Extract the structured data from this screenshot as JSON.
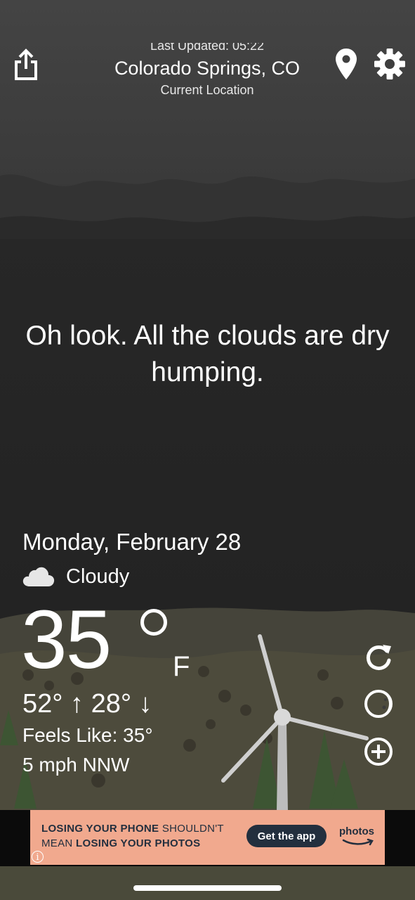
{
  "header": {
    "last_updated": "Last Updated: 05:22",
    "location_name": "Colorado Springs, CO",
    "location_sub": "Current Location"
  },
  "quip": "Oh look. All the clouds are dry humping.",
  "forecast": {
    "date": "Monday, February 28",
    "condition": "Cloudy",
    "condition_icon": "cloud-icon",
    "temperature": "35",
    "unit": "F",
    "hi_lo": "52° ↑  28° ↓",
    "feels_like": "Feels Like: 35°",
    "wind": "5 mph NNW"
  },
  "actions": {
    "share_icon": "share-icon",
    "location_icon": "map-pin-icon",
    "settings_icon": "gear-icon",
    "refresh_icon": "refresh-icon",
    "moon_icon": "moon-icon",
    "add_icon": "plus-circle-icon"
  },
  "ad": {
    "text_bold_1": "LOSING YOUR PHONE",
    "text_1": " SHOULDN'T",
    "text_2": "MEAN ",
    "text_bold_2": "LOSING YOUR PHOTOS",
    "cta": "Get the app",
    "brand": "photos",
    "info": "i"
  },
  "colors": {
    "sky_top": "#444444",
    "sky_bottom": "#232323",
    "hills": "#4d4b3c",
    "ad_background": "#f1a98e",
    "ad_text": "#232f3e"
  }
}
